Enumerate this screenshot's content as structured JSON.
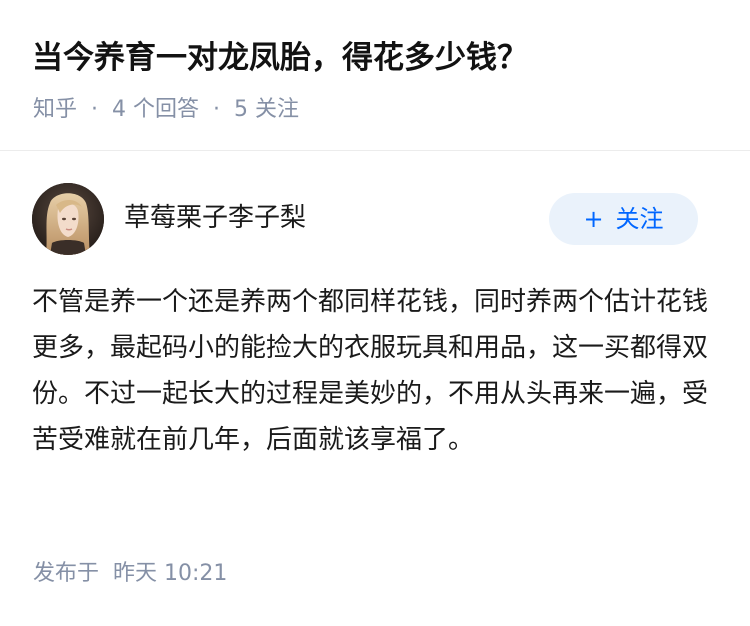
{
  "question": {
    "title": "当今养育一对龙凤胎，得花多少钱？",
    "source": "知乎",
    "answer_count": "4 个回答",
    "follower_count": "5 关注"
  },
  "answer": {
    "author": {
      "name": "草莓栗子李子梨",
      "avatar_icon": "user-avatar-photo"
    },
    "follow_button": {
      "plus": "+",
      "label": "关注",
      "color": "#0066ff",
      "background": "#eaf2fb"
    },
    "content": "不管是养一个还是养两个都同样花钱，同时养两个估计花钱更多，最起码小的能捡大的衣服玩具和用品，这一买都得双份。不过一起长大的过程是美妙的，不用从头再来一遍，受苦受难就在前几年，后面就该享福了。",
    "published": {
      "label": "发布于",
      "time": "昨天 10:21"
    }
  },
  "colors": {
    "meta_text": "#8590a6",
    "title_text": "#121212",
    "body_text": "#1a1a1a",
    "divider": "#ececec"
  }
}
